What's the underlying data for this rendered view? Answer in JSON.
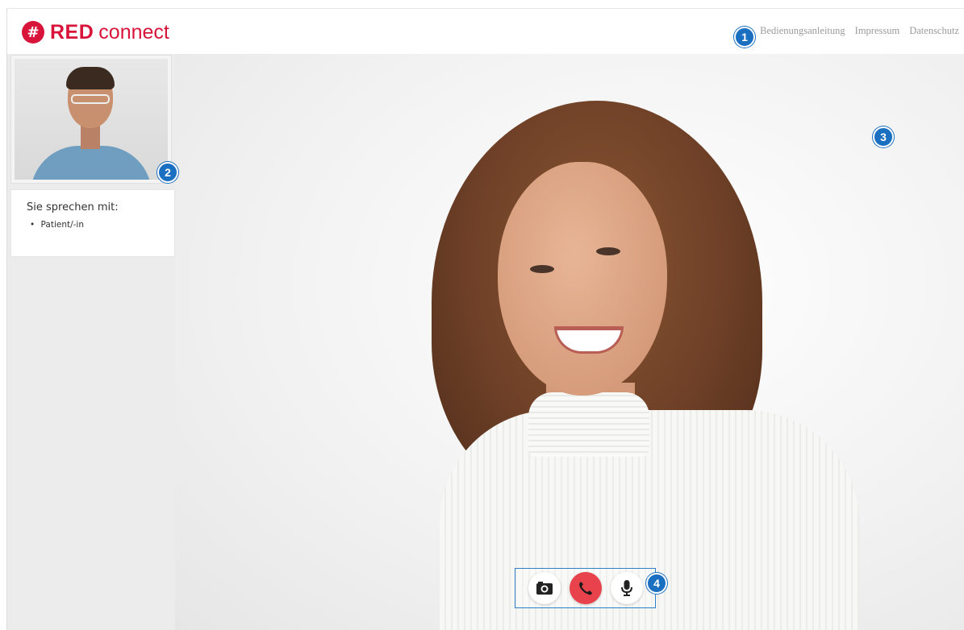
{
  "brand": {
    "mark": "#",
    "name_bold": "RED",
    "name_light": "connect",
    "color": "#d8143a"
  },
  "nav": {
    "items": [
      "Bedienungsanleitung",
      "Impressum",
      "Datenschutz"
    ]
  },
  "badges": {
    "b1": "1",
    "b2": "2",
    "b3": "3",
    "b4": "4",
    "color": "#1a6fc1"
  },
  "sidebar": {
    "info_title": "Sie sprechen mit:",
    "participants": [
      "Patient/-in"
    ]
  },
  "controls": {
    "camera_icon": "camera-icon",
    "hangup_icon": "phone-hangup-icon",
    "mic_icon": "microphone-icon",
    "hangup_color": "#e8434d"
  }
}
